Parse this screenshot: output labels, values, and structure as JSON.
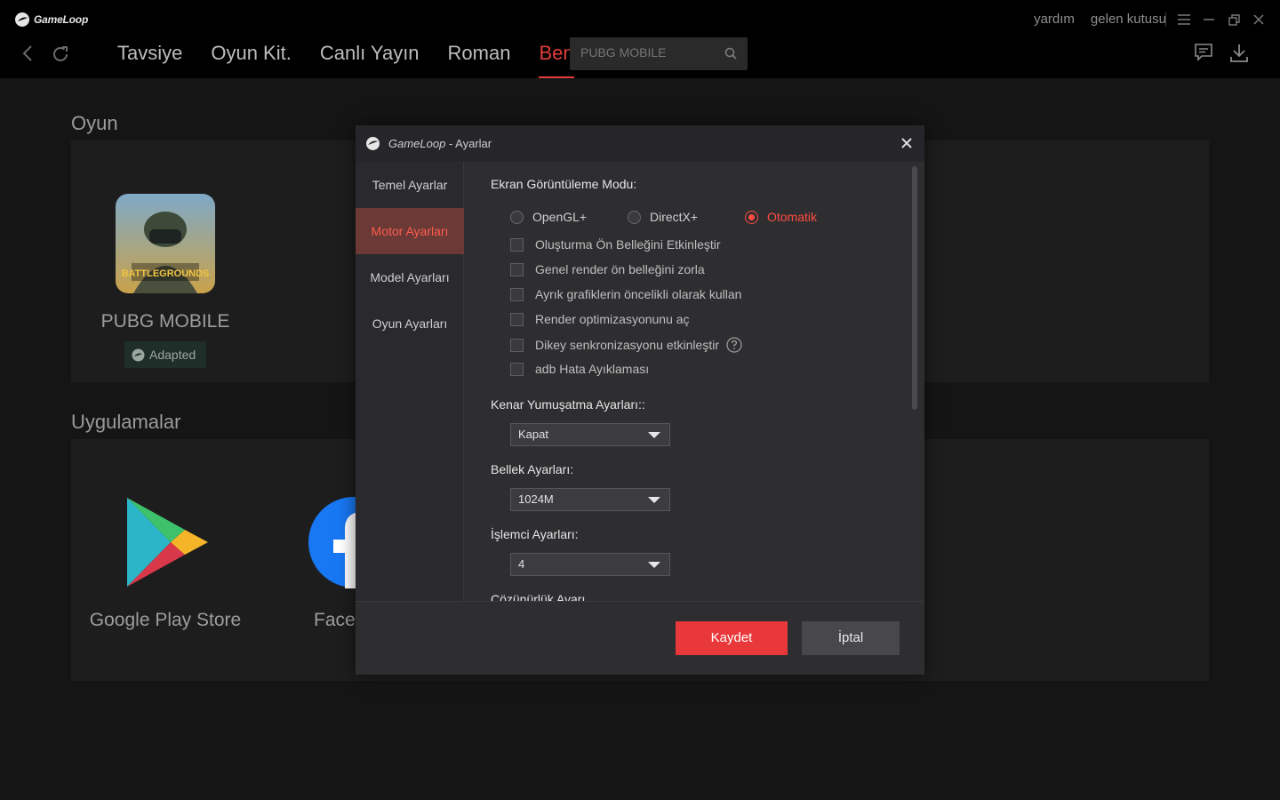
{
  "app": {
    "brand": "GameLoop"
  },
  "window_links": {
    "help": "yardım",
    "inbox": "gelen kutusu"
  },
  "nav": {
    "tabs": [
      {
        "label": "Tavsiye",
        "active": false
      },
      {
        "label": "Oyun Kit.",
        "active": false
      },
      {
        "label": "Canlı Yayın",
        "active": false
      },
      {
        "label": "Roman",
        "active": false
      },
      {
        "label": "Ben",
        "active": true
      }
    ],
    "search_placeholder": "PUBG MOBILE"
  },
  "library": {
    "games_title": "Oyun",
    "game_name": "PUBG MOBILE",
    "game_icon_text": "BATTLEGROUNDS",
    "badge": "Adapted",
    "apps_title": "Uygulamalar",
    "app1_name": "Google Play Store",
    "app2_name": "Faceb"
  },
  "dialog": {
    "title_brand": "GameLoop",
    "title_suffix": " - Ayarlar",
    "sidebar": [
      {
        "label": "Temel Ayarlar",
        "active": false
      },
      {
        "label": "Motor Ayarları",
        "active": true
      },
      {
        "label": "Model Ayarları",
        "active": false
      },
      {
        "label": "Oyun Ayarları",
        "active": false
      }
    ],
    "display_mode_label": "Ekran Görüntüleme Modu:",
    "display_modes": [
      {
        "label": "OpenGL+",
        "checked": false
      },
      {
        "label": "DirectX+",
        "checked": false
      },
      {
        "label": "Otomatik",
        "checked": true
      }
    ],
    "checkboxes": [
      {
        "label": "Oluşturma Ön Belleğini Etkinleştir",
        "checked": false
      },
      {
        "label": "Genel render ön belleğini zorla",
        "checked": false
      },
      {
        "label": "Ayrık grafiklerin öncelikli olarak kullan",
        "checked": false
      },
      {
        "label": "Render optimizasyonunu aç",
        "checked": false
      },
      {
        "label": "Dikey senkronizasyonu etkinleştir",
        "checked": false
      },
      {
        "label": "adb Hata Ayıklaması",
        "checked": false
      }
    ],
    "antialias_label": "Kenar Yumuşatma Ayarları::",
    "antialias_value": "Kapat",
    "memory_label": "Bellek Ayarları:",
    "memory_value": "1024M",
    "cpu_label": "İşlemci Ayarları:",
    "cpu_value": "4",
    "resolution_label": "Çözünürlük Ayarı",
    "save_label": "Kaydet",
    "cancel_label": "İptal"
  },
  "colors": {
    "accent": "#e8383a",
    "active_text": "#ff4b40",
    "nav_active": "#e23c3c"
  }
}
